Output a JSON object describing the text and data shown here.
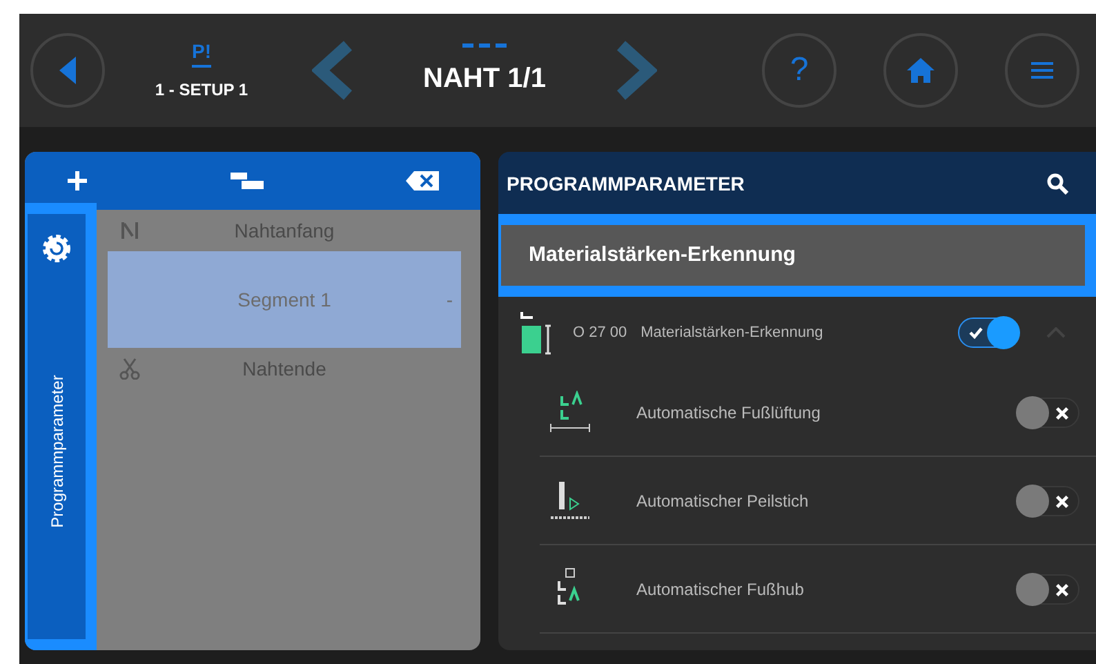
{
  "header": {
    "program_badge": "P!",
    "program_name": "1 - SETUP 1",
    "seam_title": "NAHT 1/1",
    "help_label": "?"
  },
  "seam_list": {
    "items": [
      {
        "label": "Nahtanfang",
        "selected": false,
        "kind": "start"
      },
      {
        "label": "Segment 1",
        "selected": true,
        "kind": "segment",
        "trailing": "-"
      },
      {
        "label": "Nahtende",
        "selected": false,
        "kind": "end"
      }
    ]
  },
  "side_tab": {
    "label": "Programmparameter",
    "highlighted": true
  },
  "parameters": {
    "title": "PROGRAMMPARAMETER",
    "group": {
      "label": "Materialstärken-Erkennung",
      "highlighted": true
    },
    "main": {
      "code": "O 27 00",
      "label": "Materialstärken-Erkennung",
      "on": true,
      "expanded": true
    },
    "items": [
      {
        "label": "Automatische Fußlüftung",
        "on": false,
        "kind": "lift"
      },
      {
        "label": "Automatischer Peilstich",
        "on": false,
        "kind": "needle"
      },
      {
        "label": "Automatischer Fußhub",
        "on": false,
        "kind": "stroke"
      }
    ]
  }
}
